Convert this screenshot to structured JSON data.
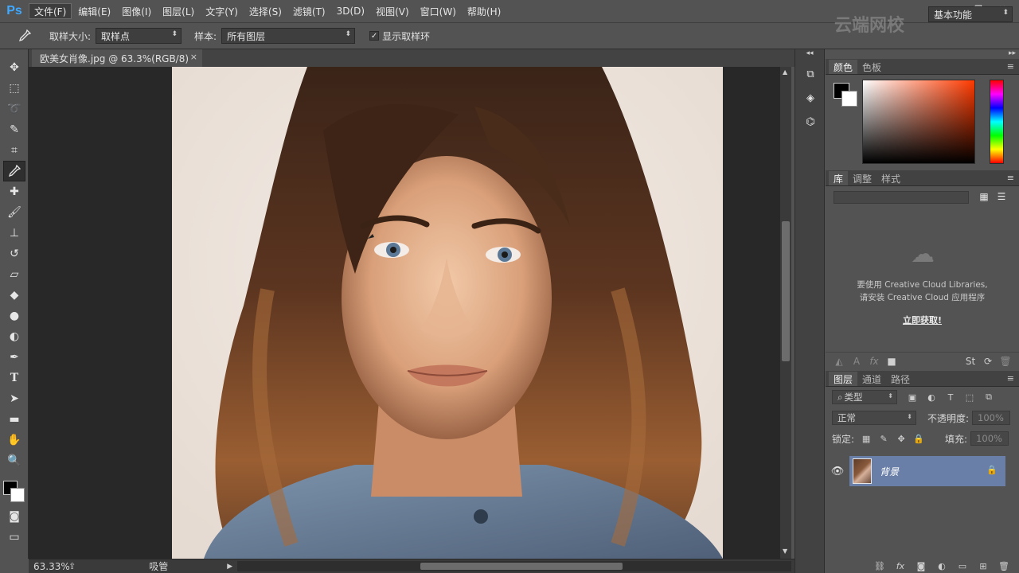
{
  "app": {
    "logo": "Ps"
  },
  "menu": {
    "items": [
      "文件(F)",
      "编辑(E)",
      "图像(I)",
      "图层(L)",
      "文字(Y)",
      "选择(S)",
      "滤镜(T)",
      "3D(D)",
      "视图(V)",
      "窗口(W)",
      "帮助(H)"
    ]
  },
  "window_controls": {
    "minimize": "—",
    "restore": "❐",
    "close": "✕"
  },
  "options": {
    "sample_size_label": "取样大小:",
    "sample_size_value": "取样点",
    "sample_label": "样本:",
    "sample_value": "所有图层",
    "show_ring_label": "显示取样环",
    "show_ring_checked": true,
    "workspace": "基本功能"
  },
  "watermark": {
    "text": "云端网校"
  },
  "document": {
    "tab_title": "欧美女肖像.jpg @ 63.3%(RGB/8)",
    "close": "×"
  },
  "status": {
    "zoom": "63.33%",
    "tool": "吸管"
  },
  "panels": {
    "color_tabs": [
      "颜色",
      "色板"
    ],
    "library_tabs": [
      "库",
      "调整",
      "样式"
    ],
    "library_msg1": "要使用 Creative Cloud Libraries,",
    "library_msg2": "请安装 Creative Cloud 应用程序",
    "library_get": "立即获取!",
    "layers_tabs": [
      "图层",
      "通道",
      "路径"
    ],
    "filter_kind": "类型",
    "blend_mode": "正常",
    "opacity_label": "不透明度:",
    "opacity_value": "100%",
    "lock_label": "锁定:",
    "fill_label": "填充:",
    "fill_value": "100%",
    "layer_name": "背景"
  },
  "colors": {
    "foreground": "#000000",
    "background": "#ffffff",
    "selected_layer": "#6a7fa8"
  }
}
